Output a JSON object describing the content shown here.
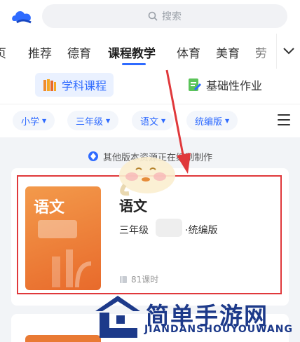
{
  "search": {
    "placeholder": "搜索"
  },
  "tabs": [
    {
      "label": "页"
    },
    {
      "label": "推荐"
    },
    {
      "label": "德育"
    },
    {
      "label": "课程教学"
    },
    {
      "label": "体育"
    },
    {
      "label": "美育"
    },
    {
      "label": "劳"
    }
  ],
  "categories": [
    {
      "label": "学科课程"
    },
    {
      "label": "基础性作业"
    }
  ],
  "filters": [
    {
      "label": "小学"
    },
    {
      "label": "三年级"
    },
    {
      "label": "语文"
    },
    {
      "label": "统编版"
    }
  ],
  "notice": {
    "text": "其他版本资源正在编制制作"
  },
  "course": {
    "cover_title": "语文",
    "subject": "语文",
    "grade": "三年级",
    "edition": "·统编版",
    "hours": "81课时"
  },
  "watermark": {
    "title": "简单手游网",
    "subtitle": "JIANDANSHOUYOUWANG"
  },
  "colors": {
    "accent": "#2f6bff",
    "highlight": "#e0383b",
    "cover": "#ee7d38"
  }
}
